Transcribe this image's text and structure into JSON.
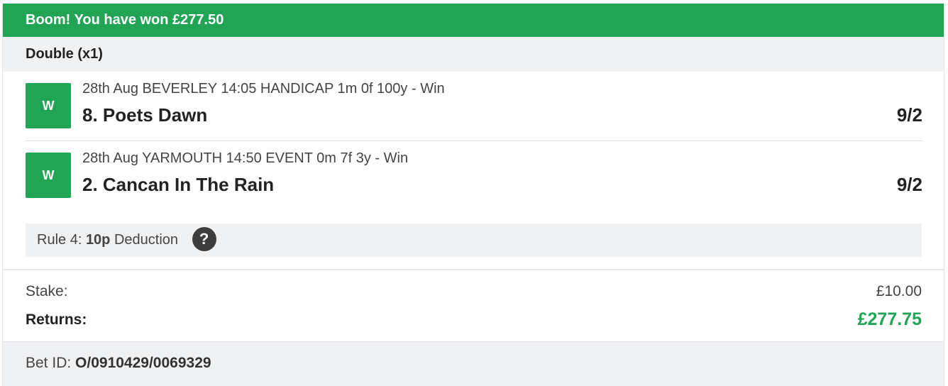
{
  "banner": {
    "text": "Boom! You have won £277.50"
  },
  "bet": {
    "type_label": "Double (x1)",
    "selections": [
      {
        "badge": "W",
        "description": "28th Aug BEVERLEY 14:05 HANDICAP 1m 0f 100y - Win",
        "name": "8. Poets Dawn",
        "odds": "9/2"
      },
      {
        "badge": "W",
        "description": "28th Aug YARMOUTH 14:50 EVENT 0m 7f 3y - Win",
        "name": "2. Cancan In The Rain",
        "odds": "9/2"
      }
    ],
    "rule4": {
      "prefix": "Rule 4:",
      "amount": "10p",
      "suffix": "Deduction",
      "help_icon": "?"
    },
    "stake": {
      "label": "Stake:",
      "value": "£10.00"
    },
    "returns": {
      "label": "Returns:",
      "value": "£277.75"
    },
    "bet_id": {
      "label": "Bet ID:",
      "value": "O/0910429/0069329"
    }
  },
  "colors": {
    "accent_green": "#22a455",
    "panel_grey": "#f0f1f3",
    "help_icon_bg": "#3d3d3d"
  }
}
